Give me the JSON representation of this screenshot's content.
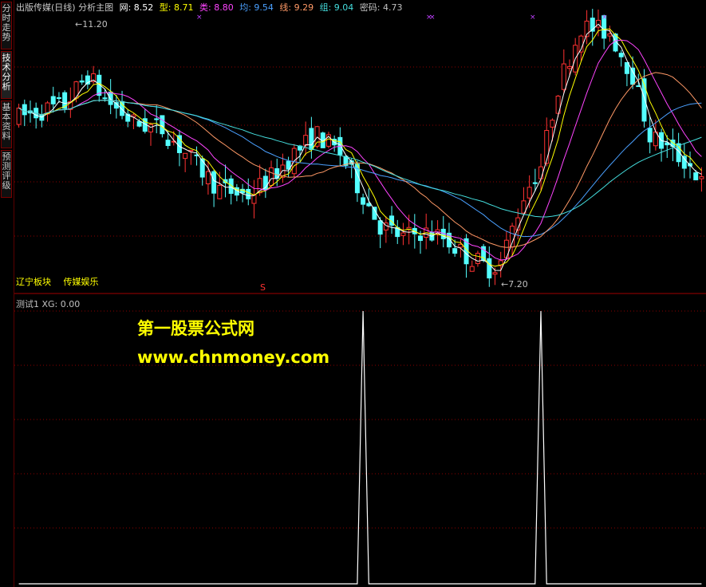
{
  "side_tabs": [
    {
      "label": "分时走势",
      "active": false
    },
    {
      "label": "技术分析",
      "active": true
    },
    {
      "label": "基本资料",
      "active": false
    },
    {
      "label": "预测评级",
      "active": false
    }
  ],
  "header": {
    "title": "出版传媒(日线) 分析主图",
    "indicators": [
      {
        "label": "网: 8.52",
        "color": "#ffffff"
      },
      {
        "label": "型: 8.71",
        "color": "#ffff00"
      },
      {
        "label": "类: 8.80",
        "color": "#ff44ff"
      },
      {
        "label": "均: 9.54",
        "color": "#4aa0ff"
      },
      {
        "label": "线: 9.29",
        "color": "#ff9966"
      },
      {
        "label": "组: 9.04",
        "color": "#44dddd"
      },
      {
        "label": "密码: 4.73",
        "color": "#c0c0c0"
      }
    ]
  },
  "price_high_label": "11.20",
  "price_low_label": "7.20",
  "board_labels": [
    "辽宁板块",
    "传媒娱乐"
  ],
  "signal_marker": "S",
  "lower_panel": {
    "header": "测试1  XG: 0.00",
    "watermark_title": "第一股票公式网",
    "watermark_url": "www.chnmoney.com"
  },
  "colors": {
    "up": "#ff3232",
    "down": "#54ffff",
    "ma_white": "#ffffff",
    "ma_yellow": "#ffff00",
    "ma_magenta": "#ff44ff",
    "ma_blue": "#4aa0ff",
    "ma_orange": "#ff9966",
    "ma_cyan": "#44dddd",
    "grid": "#8b0000",
    "watermark": "#ffff00"
  },
  "chart_data": {
    "type": "line",
    "title": "出版传媒(日线)",
    "ylim": [
      7.0,
      11.6
    ],
    "n_days": 120,
    "xg_spike_days": [
      60,
      91
    ],
    "xg_ylim": [
      0,
      1
    ],
    "series": [
      {
        "name": "XG",
        "values": "0 except 1 at spike days"
      }
    ]
  }
}
